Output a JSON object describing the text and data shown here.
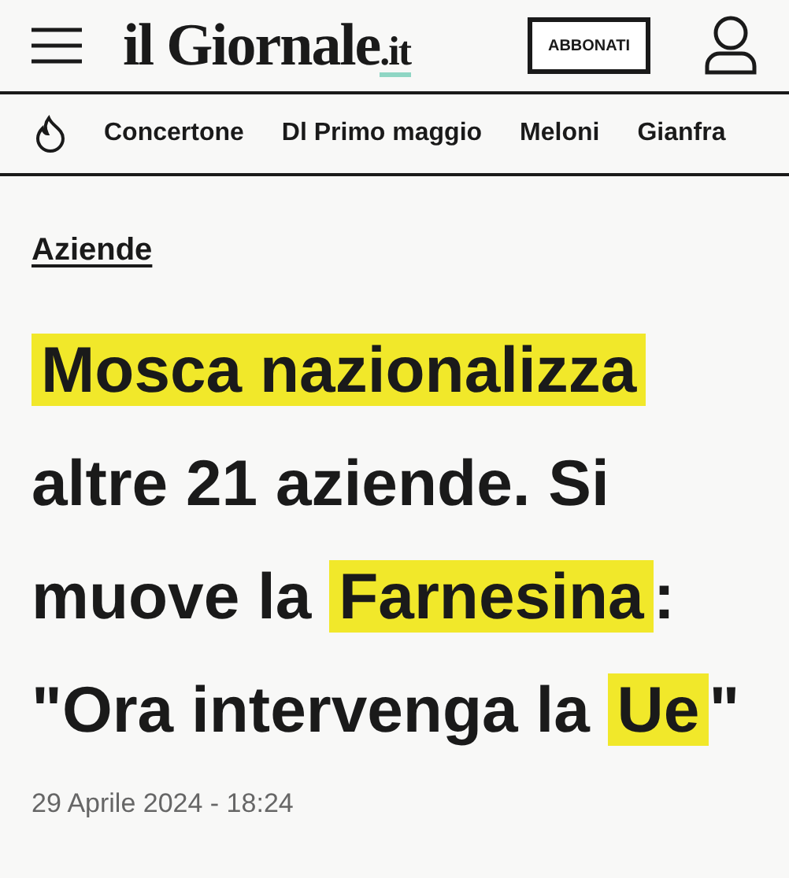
{
  "header": {
    "logo": "il Giornale",
    "logo_suffix": ".it",
    "subscribe_button": "ABBONATI"
  },
  "trending": [
    "Concertone",
    "Dl Primo maggio",
    "Meloni",
    "Gianfra"
  ],
  "article": {
    "category": "Aziende",
    "headline": [
      {
        "text": "Mosca nazionalizza",
        "highlighted": true
      },
      {
        "text": " altre 21 aziende. Si muove la ",
        "highlighted": false
      },
      {
        "text": "Farnesina",
        "highlighted": true
      },
      {
        "text": ": \"Ora intervenga la ",
        "highlighted": false
      },
      {
        "text": "Ue",
        "highlighted": true
      },
      {
        "text": "\"",
        "highlighted": false
      }
    ],
    "date": "29 Aprile 2024 - 18:24"
  }
}
